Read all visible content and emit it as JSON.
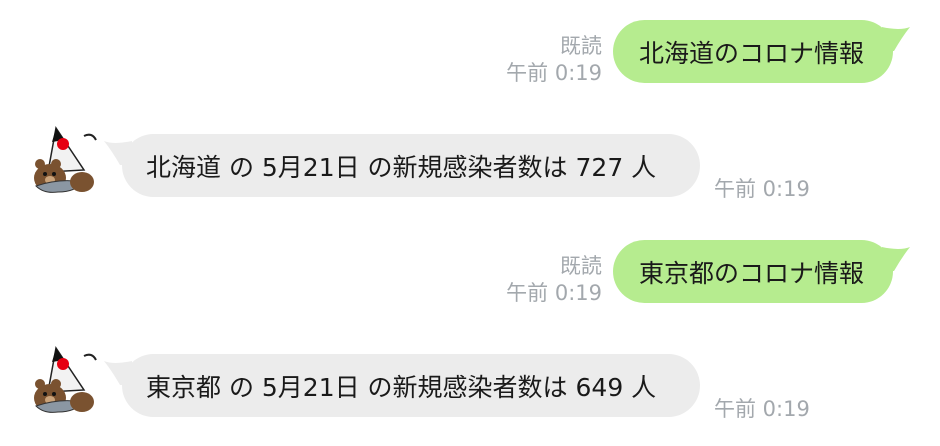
{
  "messages": [
    {
      "direction": "out",
      "read_label": "既読",
      "time": "午前 0:19",
      "text": "北海道のコロナ情報"
    },
    {
      "direction": "in",
      "time": "午前 0:19",
      "text": "北海道 の 5月21日 の新規感染者数は 727 人"
    },
    {
      "direction": "out",
      "read_label": "既読",
      "time": "午前 0:19",
      "text": "東京都のコロナ情報"
    },
    {
      "direction": "in",
      "time": "午前 0:19",
      "text": "東京都 の 5月21日 の新規感染者数は 649 人"
    }
  ],
  "bot": {
    "avatar_icon": "duke-and-bear-icon"
  },
  "colors": {
    "outgoing_bubble": "#b6ec8f",
    "incoming_bubble": "#ececec",
    "meta_text": "#a3a8ad"
  }
}
